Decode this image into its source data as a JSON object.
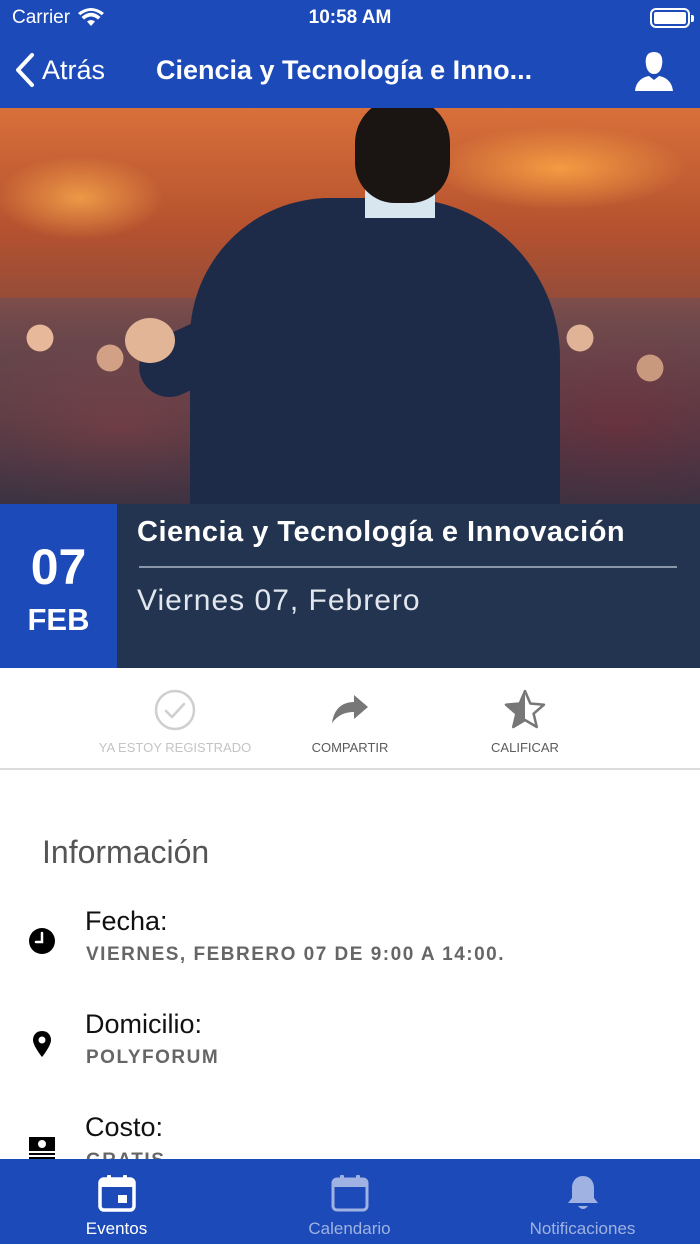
{
  "status_bar": {
    "carrier": "Carrier",
    "time": "10:58 AM"
  },
  "nav": {
    "back_label": "Atrás",
    "title": "Ciencia y Tecnología e Inno..."
  },
  "event": {
    "day": "07",
    "month": "FEB",
    "title": "Ciencia y Tecnología e Innovación",
    "date_text": "Viernes 07, Febrero"
  },
  "actions": [
    {
      "label": "YA ESTOY REGISTRADO",
      "icon": "check-circle-icon",
      "state": "disabled"
    },
    {
      "label": "COMPARTIR",
      "icon": "share-arrow-icon"
    },
    {
      "label": "CALIFICAR",
      "icon": "star-icon"
    }
  ],
  "info": {
    "heading": "Información",
    "rows": [
      {
        "label": "Fecha:",
        "value": "VIERNES, FEBRERO 07 DE 9:00 A 14:00.",
        "icon": "clock-icon"
      },
      {
        "label": "Domicilio:",
        "value": "POLYFORUM",
        "icon": "location-pin-icon"
      },
      {
        "label": "Costo:",
        "value": "GRATIS",
        "icon": "money-icon"
      }
    ]
  },
  "tabs": [
    {
      "label": "Eventos",
      "icon": "calendar-day-icon",
      "active": true
    },
    {
      "label": "Calendario",
      "icon": "calendar-icon",
      "active": false
    },
    {
      "label": "Notificaciones",
      "icon": "bell-icon",
      "active": false
    }
  ],
  "colors": {
    "primary": "#1c4ab8",
    "band": "#22344f",
    "tab_inactive": "#9fb2e2"
  }
}
